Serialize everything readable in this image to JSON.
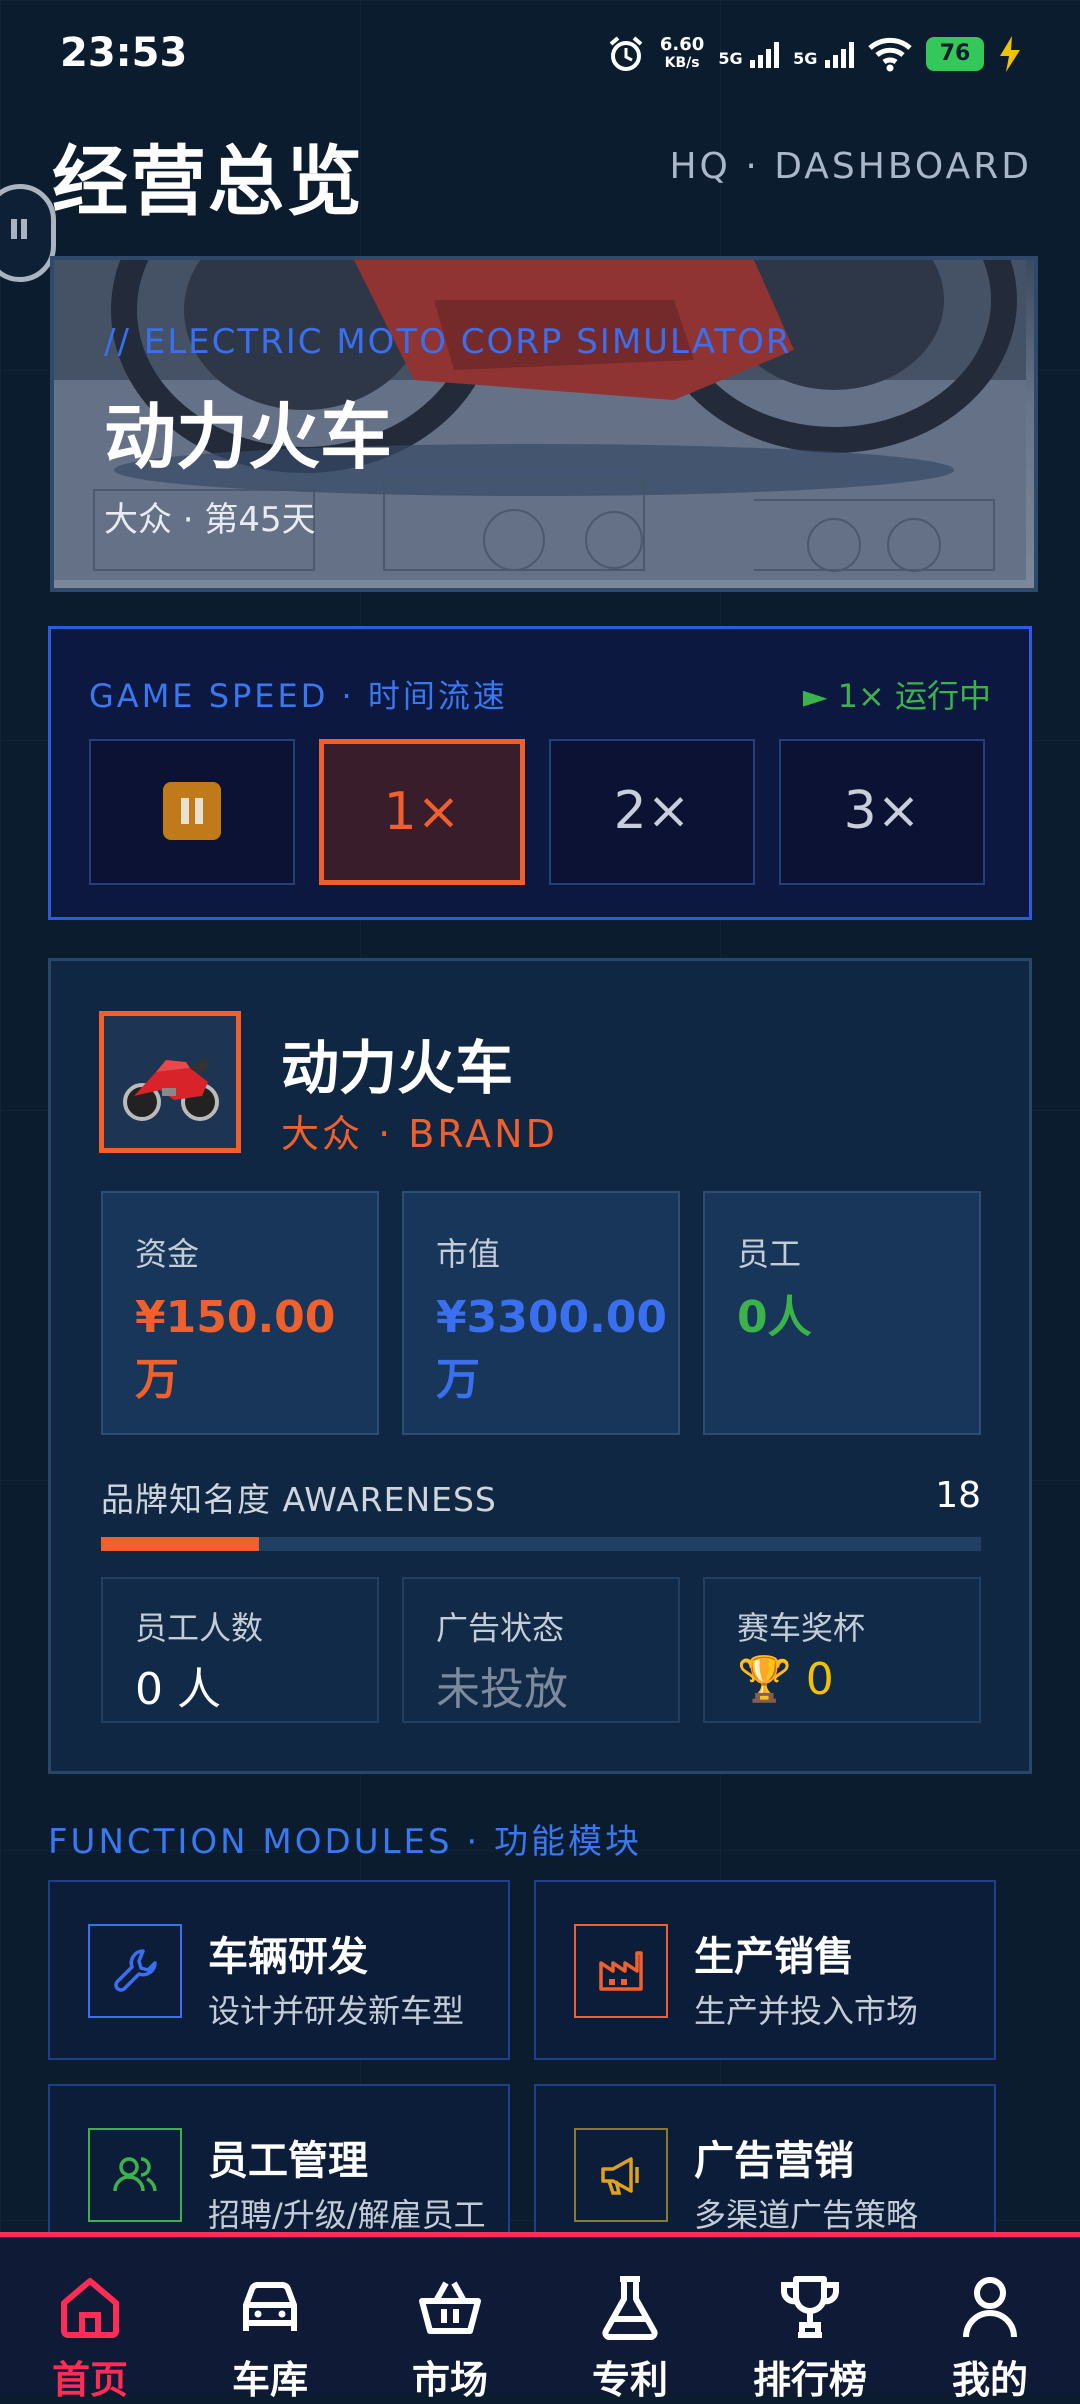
{
  "status_bar": {
    "time": "23:53",
    "net_speed_value": "6.60",
    "net_speed_unit": "KB/s",
    "sim1": "5G",
    "sim2": "5G",
    "battery": "76"
  },
  "header": {
    "title": "经营总览",
    "subtitle": "HQ · DASHBOARD"
  },
  "hero": {
    "tag": "// ELECTRIC MOTO CORP SIMULATOR",
    "title": "动力火车",
    "subtitle": "大众 · 第45天"
  },
  "game_speed": {
    "label": "GAME SPEED · 时间流速",
    "status": "► 1× 运行中",
    "options": [
      "pause",
      "1×",
      "2×",
      "3×"
    ],
    "selected": "1×"
  },
  "company": {
    "name": "动力火车",
    "brand": "大众 · BRAND",
    "stats": [
      {
        "label": "资金",
        "value": "¥150.00万",
        "color": "#f0602d"
      },
      {
        "label": "市值",
        "value": "¥3300.00万",
        "color": "#3a6ff0"
      },
      {
        "label": "员工",
        "value": "0人",
        "color": "#3cb34a"
      }
    ],
    "awareness": {
      "label": "品牌知名度 AWARENESS",
      "value": "18",
      "fraction": 0.18
    },
    "mini": [
      {
        "label": "员工人数",
        "value": "0 人"
      },
      {
        "label": "广告状态",
        "value": "未投放"
      },
      {
        "label": "赛车奖杯",
        "value": "0",
        "icon": "🏆"
      }
    ]
  },
  "modules": {
    "label": "FUNCTION MODULES · 功能模块",
    "items": [
      {
        "title": "车辆研发",
        "desc": "设计并研发新车型",
        "icon": "wrench-icon",
        "color": "#3a6ff0"
      },
      {
        "title": "生产销售",
        "desc": "生产并投入市场",
        "icon": "factory-icon",
        "color": "#f0602d"
      },
      {
        "title": "员工管理",
        "desc": "招聘/升级/解雇员工",
        "icon": "people-icon",
        "color": "#3cb34a"
      },
      {
        "title": "广告营销",
        "desc": "多渠道广告策略",
        "icon": "megaphone-icon",
        "color": "#e0a020"
      }
    ]
  },
  "nav": {
    "items": [
      {
        "label": "首页",
        "icon": "home-icon"
      },
      {
        "label": "车库",
        "icon": "car-icon"
      },
      {
        "label": "市场",
        "icon": "basket-icon"
      },
      {
        "label": "专利",
        "icon": "flask-icon"
      },
      {
        "label": "排行榜",
        "icon": "trophy-icon"
      },
      {
        "label": "我的",
        "icon": "user-icon"
      }
    ],
    "active": "首页"
  }
}
